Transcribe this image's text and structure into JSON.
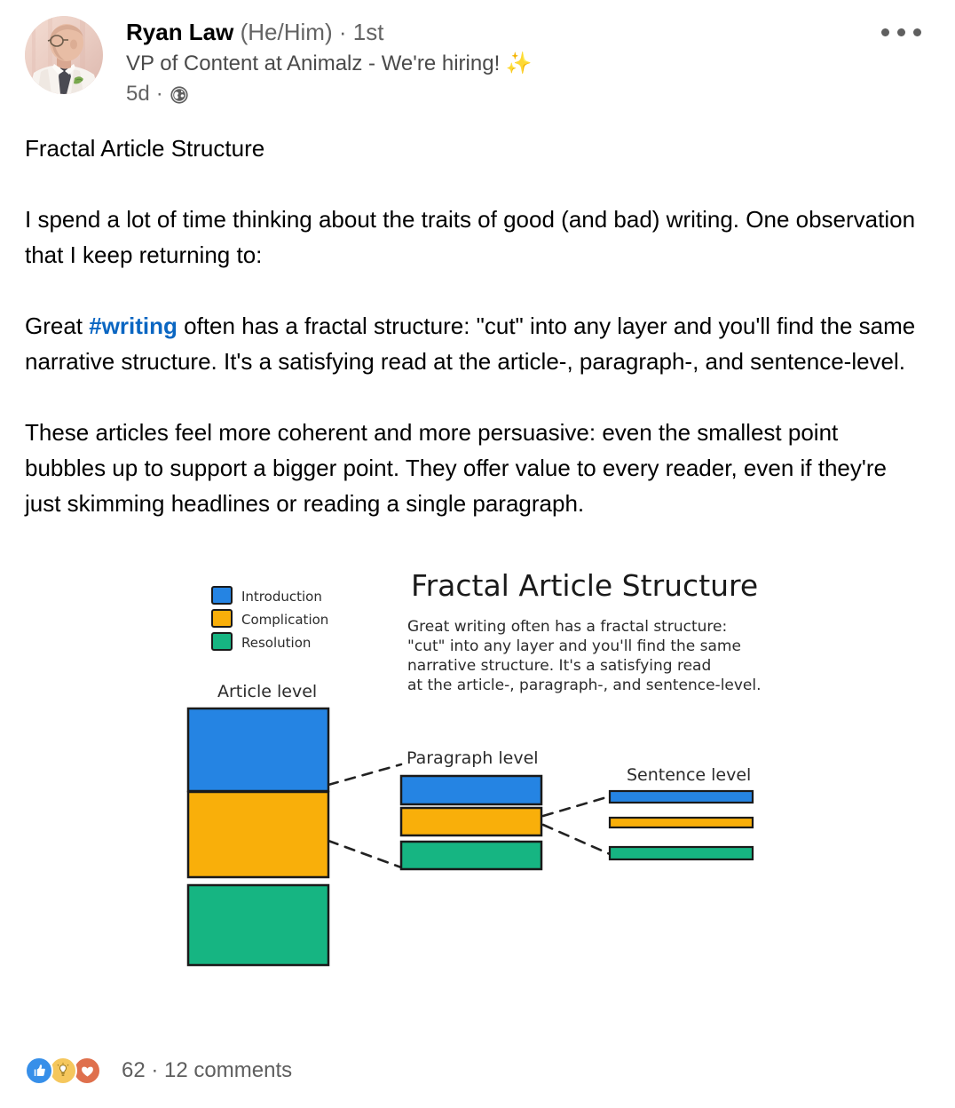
{
  "post": {
    "author": {
      "name": "Ryan Law",
      "pronouns": "(He/Him)",
      "separator": "·",
      "degree": "1st",
      "headline": "VP of Content at Animalz - We're hiring!",
      "headline_emoji": "✨",
      "timestamp": "5d",
      "time_separator": "·",
      "visibility": "public-globe"
    },
    "overflow_menu_label": "More actions",
    "body": {
      "title": "Fractal Article Structure",
      "paragraph_1": "I spend a lot of time thinking about the traits of good (and bad) writing. One observation that I keep returning to:",
      "paragraph_2_pre": "Great ",
      "hashtag": "#writing",
      "paragraph_2_post": " often has a fractal structure: \"cut\" into any layer and you'll find the same narrative structure. It's a satisfying read at the article-, paragraph-, and sentence-level.",
      "paragraph_3": "These articles feel more coherent and more persuasive: even the smallest point bubbles up to support a bigger point. They offer value to every reader, even if they're just skimming headlines or reading a single paragraph."
    },
    "social": {
      "reactions": [
        {
          "name": "like-reaction-icon",
          "label": "Like"
        },
        {
          "name": "insightful-reaction-icon",
          "label": "Insightful"
        },
        {
          "name": "love-reaction-icon",
          "label": "Love"
        }
      ],
      "reaction_count": "62",
      "count_separator": "·",
      "comments": "12 comments"
    }
  },
  "diagram": {
    "title": "Fractal Article Structure",
    "description_lines": [
      "Great writing often has a fractal structure:",
      "\"cut\" into any layer and you'll find the same",
      "narrative structure. It's a satisfying read",
      "at the article-, paragraph-, and sentence-level."
    ],
    "legend": [
      {
        "label": "Introduction",
        "color": "#2584E3"
      },
      {
        "label": "Complication",
        "color": "#F9AF0A"
      },
      {
        "label": "Resolution",
        "color": "#16B582"
      }
    ],
    "levels": [
      {
        "label": "Article level"
      },
      {
        "label": "Paragraph level"
      },
      {
        "label": "Sentence level"
      }
    ],
    "colors": {
      "introduction": "#2584E3",
      "complication": "#F9AF0A",
      "resolution": "#16B582",
      "outline": "#1a1a1a",
      "connector": "#222222"
    }
  }
}
